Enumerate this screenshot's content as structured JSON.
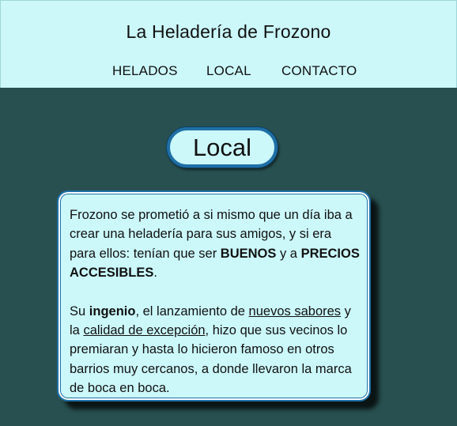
{
  "header": {
    "title": "La Heladería de Frozono",
    "nav": [
      {
        "label": "HELADOS"
      },
      {
        "label": "LOCAL"
      },
      {
        "label": "CONTACTO"
      }
    ]
  },
  "section": {
    "title": "Local"
  },
  "content": {
    "p1": {
      "t1": "Frozono se prometió a si mismo que un día iba a crear una heladería para sus amigos, y si era para ellos: tenían que ser ",
      "b1": "BUENOS",
      "t2": " y a ",
      "b2": "PRECIOS ACCESIBLES",
      "t3": "."
    },
    "p2": {
      "t1": "Su ",
      "b1": "ingenio",
      "t2": ", el lanzamiento de ",
      "u1": "nuevos sabores",
      "t3": " y la ",
      "u2": "calidad de excepción",
      "t4": ", hizo que sus vecinos lo premiaran y hasta lo hicieron famoso en otros barrios muy cercanos, a donde llevaron la marca de boca en boca."
    }
  },
  "colors": {
    "header_bg": "#ccf8fa",
    "page_bg": "#285050",
    "accent_border": "#1f6fa6"
  }
}
